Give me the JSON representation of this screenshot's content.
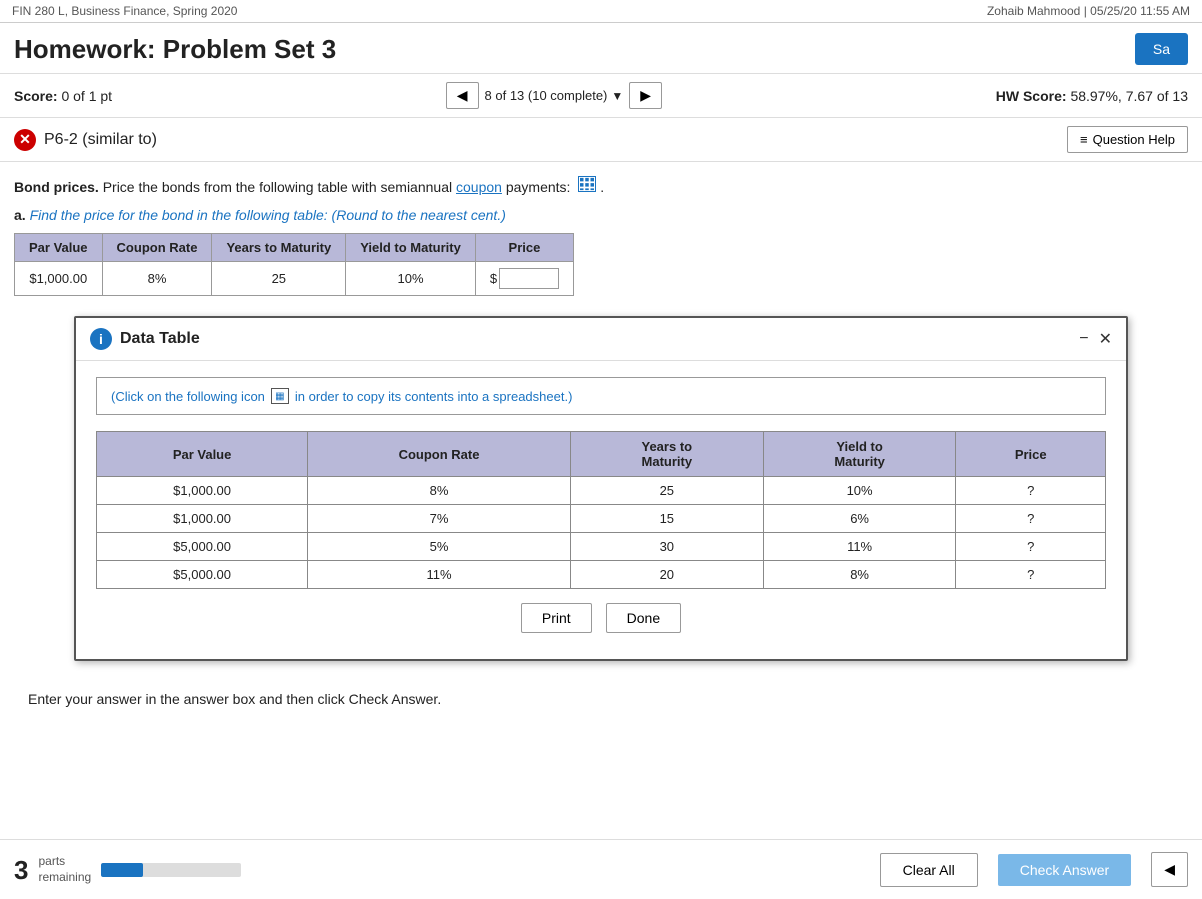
{
  "topBar": {
    "left": "FIN 280 L, Business Finance, Spring 2020",
    "right": "Zohaib Mahmood  |  05/25/20 11:55 AM"
  },
  "header": {
    "title": "Homework: Problem Set 3",
    "saveLabel": "Sa"
  },
  "scoreRow": {
    "scoreLabel": "Score:",
    "scoreValue": "0 of 1 pt",
    "navProgress": "8 of 13 (10 complete)",
    "hwScoreLabel": "HW Score:",
    "hwScoreValue": "58.97%, 7.67 of 13"
  },
  "problemRow": {
    "problemId": "P6-2 (similar to)",
    "questionHelpLabel": "Question Help"
  },
  "bondIntro": {
    "text1": "Bond prices.",
    "text2": " Price the bonds from the following table with semiannual ",
    "couponLink": "coupon",
    "text3": " payments:"
  },
  "subQuestion": {
    "label": "a.",
    "text": " Find the price for the bond in the following table:",
    "hint": "(Round to the nearest cent.)"
  },
  "mainTable": {
    "headers": [
      "Par Value",
      "Coupon Rate",
      "Years to Maturity",
      "Yield to Maturity",
      "Price"
    ],
    "row": {
      "parValue": "$1,000.00",
      "couponRate": "8%",
      "yearsToMaturity": "25",
      "yieldToMaturity": "10%",
      "priceDollarSign": "$",
      "priceInput": ""
    }
  },
  "dataTableModal": {
    "title": "Data Table",
    "copyHint1": "(Click on the following icon",
    "copyHint2": "in order to copy its contents into a spreadsheet.)",
    "tableHeaders": [
      "Par Value",
      "Coupon Rate",
      "Years to Maturity",
      "Yield to Maturity",
      "Price"
    ],
    "rows": [
      {
        "parValue": "$1,000.00",
        "couponRate": "8%",
        "yearsToMaturity": "25",
        "yieldToMaturity": "10%",
        "price": "?"
      },
      {
        "parValue": "$1,000.00",
        "couponRate": "7%",
        "yearsToMaturity": "15",
        "yieldToMaturity": "6%",
        "price": "?"
      },
      {
        "parValue": "$5,000.00",
        "couponRate": "5%",
        "yearsToMaturity": "30",
        "yieldToMaturity": "11%",
        "price": "?"
      },
      {
        "parValue": "$5,000.00",
        "couponRate": "11%",
        "yearsToMaturity": "20",
        "yieldToMaturity": "8%",
        "price": "?"
      }
    ],
    "printLabel": "Print",
    "doneLabel": "Done"
  },
  "instruction": "Enter your answer in the answer box and then click Check Answer.",
  "footer": {
    "partsNumber": "3",
    "partsText": "parts\nremaining",
    "progressPercent": 30,
    "clearAllLabel": "Clear All",
    "checkAnswerLabel": "Check Answer"
  }
}
